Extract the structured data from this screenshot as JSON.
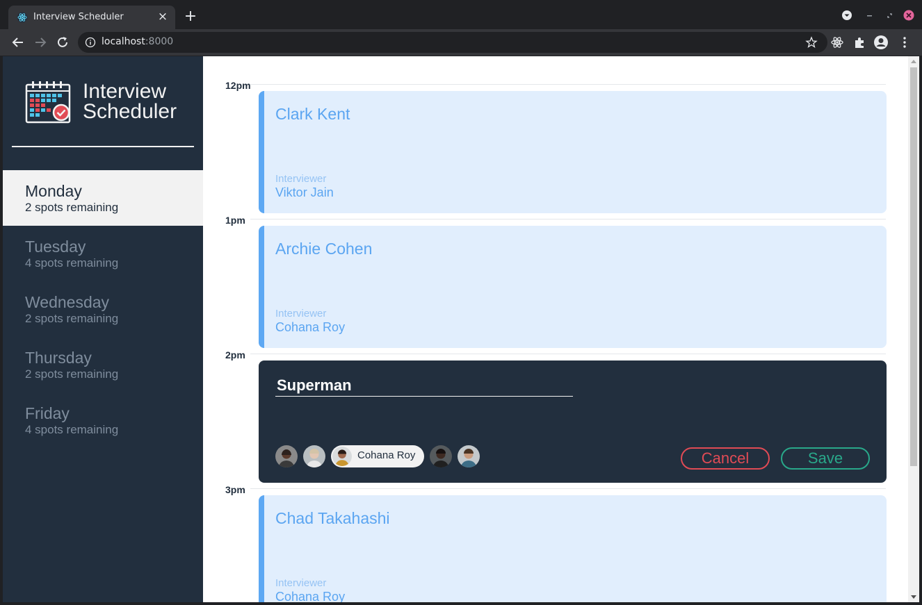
{
  "browser": {
    "tab_title": "Interview Scheduler",
    "url_host": "localhost",
    "url_port": ":8000"
  },
  "app": {
    "brand_line1": "Interview",
    "brand_line2": "Scheduler"
  },
  "days": [
    {
      "name": "Monday",
      "spots": "2 spots remaining",
      "selected": true
    },
    {
      "name": "Tuesday",
      "spots": "4 spots remaining",
      "selected": false
    },
    {
      "name": "Wednesday",
      "spots": "2 spots remaining",
      "selected": false
    },
    {
      "name": "Thursday",
      "spots": "2 spots remaining",
      "selected": false
    },
    {
      "name": "Friday",
      "spots": "4 spots remaining",
      "selected": false
    }
  ],
  "schedule": {
    "times": [
      "12pm",
      "1pm",
      "2pm",
      "3pm"
    ],
    "appointments": [
      {
        "student": "Clark Kent",
        "interviewer_label": "Interviewer",
        "interviewer": "Viktor Jain"
      },
      {
        "student": "Archie Cohen",
        "interviewer_label": "Interviewer",
        "interviewer": "Cohana Roy"
      },
      {
        "student": "Chad Takahashi",
        "interviewer_label": "Interviewer",
        "interviewer": "Cohana Roy"
      }
    ],
    "form": {
      "student_value": "Superman",
      "selected_interviewer": "Cohana Roy",
      "cancel_label": "Cancel",
      "save_label": "Save"
    }
  },
  "colors": {
    "sidebar": "#222f3e",
    "appointment_bg": "#e1eefd",
    "appointment_accent": "#5da8f3",
    "cancel": "#e14b55",
    "save": "#29a88a"
  }
}
